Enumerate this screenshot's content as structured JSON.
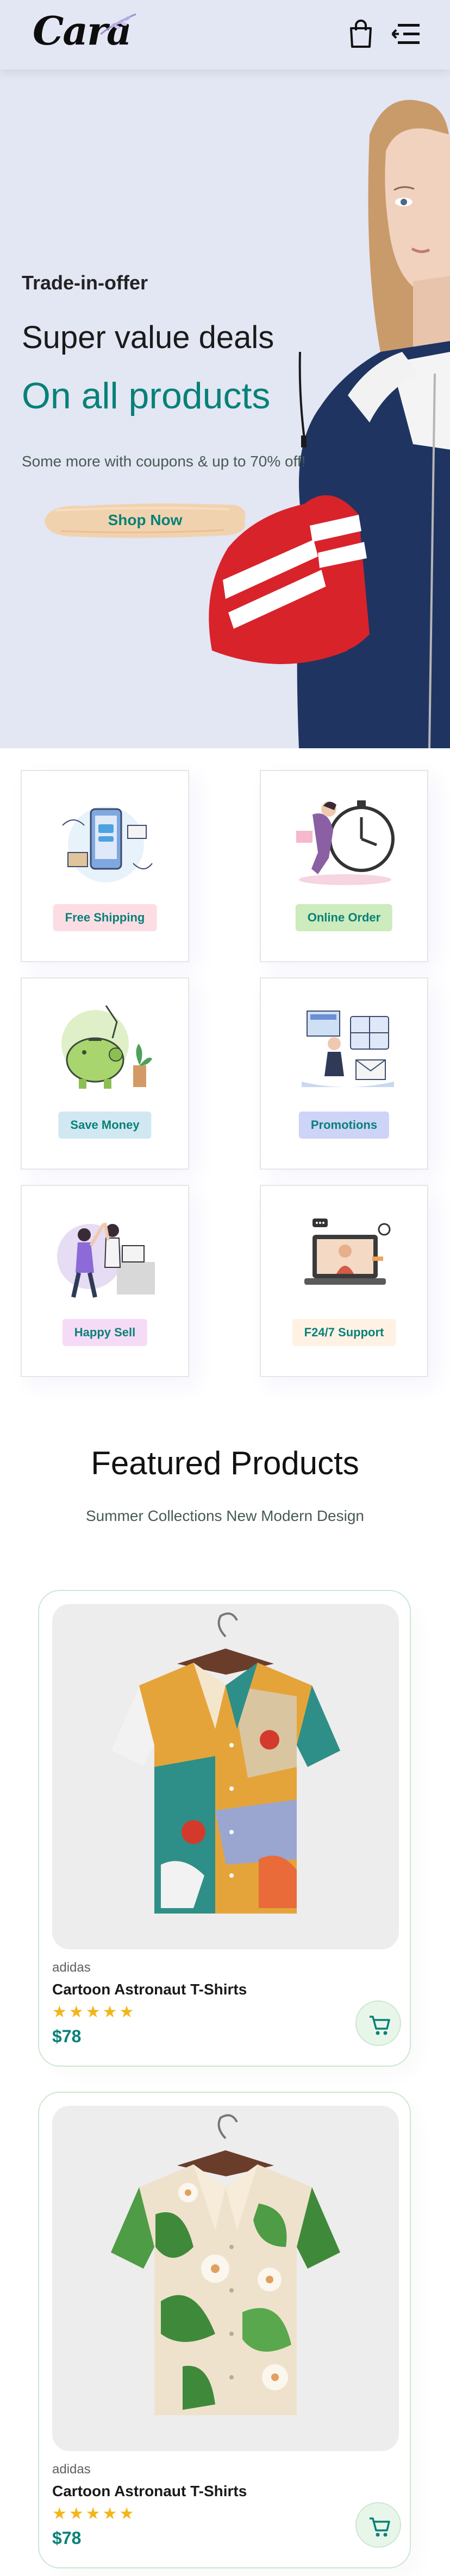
{
  "header": {
    "logo_text": "Cara",
    "cart_icon": "shopping-bag-icon",
    "menu_icon": "menu-collapse-icon"
  },
  "hero": {
    "eyebrow": "Trade-in-offer",
    "headline": "Super value deals",
    "highlight": "On all products",
    "subtext": "Some more with coupons & up to 70% off!",
    "cta_label": "Shop Now"
  },
  "features": [
    {
      "label": "Free Shipping",
      "icon": "phone-delivery-icon",
      "bg": "#fddde4"
    },
    {
      "label": "Online Order",
      "icon": "stopwatch-order-icon",
      "bg": "#cdebbc"
    },
    {
      "label": "Save Money",
      "icon": "piggy-bank-icon",
      "bg": "#d1e8f2"
    },
    {
      "label": "Promotions",
      "icon": "promotion-board-icon",
      "bg": "#cdd4f8"
    },
    {
      "label": "Happy Sell",
      "icon": "high-five-icon",
      "bg": "#f6dbf6"
    },
    {
      "label": "F24/7 Support",
      "icon": "laptop-support-icon",
      "bg": "#fff2e5"
    }
  ],
  "featured": {
    "title": "Featured Products",
    "subtitle": "Summer Collections New Modern Design"
  },
  "products": [
    {
      "brand": "adidas",
      "name": "Cartoon Astronaut T-Shirts",
      "rating": 5,
      "stars": "★★★★★",
      "price": "$78"
    },
    {
      "brand": "adidas",
      "name": "Cartoon Astronaut T-Shirts",
      "rating": 5,
      "stars": "★★★★★",
      "price": "$78"
    }
  ],
  "colors": {
    "accent": "#088178",
    "header_bg": "#e3e6f3",
    "star": "#f3b519"
  }
}
